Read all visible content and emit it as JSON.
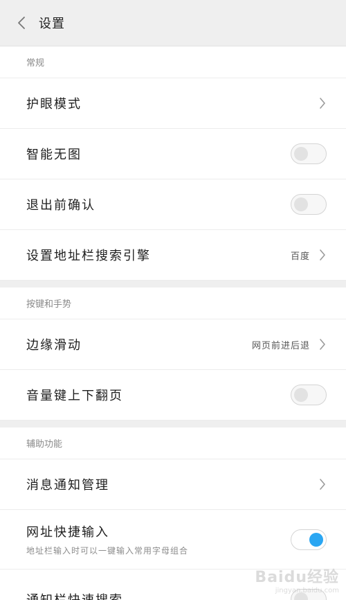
{
  "header": {
    "title": "设置"
  },
  "sections": [
    {
      "title": "常规",
      "rows": [
        {
          "label": "护眼模式"
        },
        {
          "label": "智能无图",
          "toggle": "off"
        },
        {
          "label": "退出前确认",
          "toggle": "off"
        },
        {
          "label": "设置地址栏搜索引擎",
          "value": "百度"
        }
      ]
    },
    {
      "title": "按键和手势",
      "rows": [
        {
          "label": "边缘滑动",
          "value": "网页前进后退"
        },
        {
          "label": "音量键上下翻页",
          "toggle": "off"
        }
      ]
    },
    {
      "title": "辅助功能",
      "rows": [
        {
          "label": "消息通知管理"
        },
        {
          "label": "网址快捷输入",
          "sublabel": "地址栏输入时可以一键输入常用字母组合",
          "toggle": "on"
        },
        {
          "label": "通知栏快速搜索",
          "toggle": "off"
        }
      ]
    }
  ],
  "watermark": {
    "main": "Baidu经验",
    "sub": "jingyan.baidu.com"
  },
  "colors": {
    "toggle_on": "#2aa6f2",
    "header_bg": "#efefef"
  }
}
